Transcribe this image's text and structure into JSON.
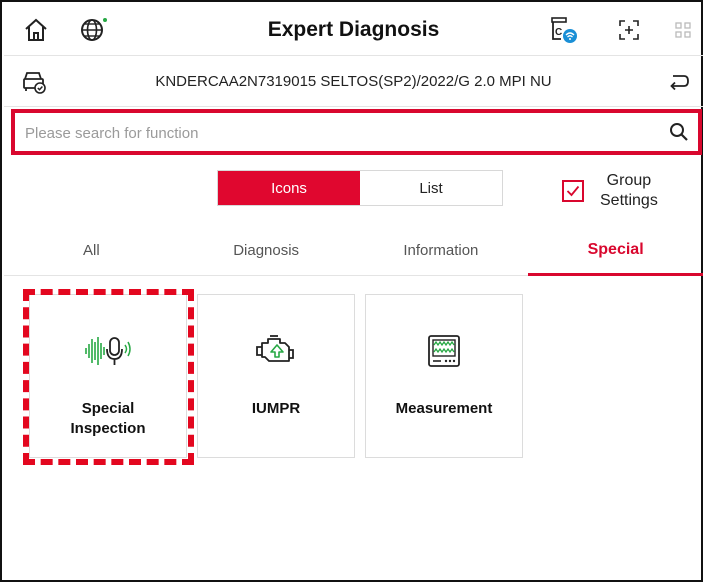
{
  "header": {
    "title": "Expert Diagnosis",
    "icons": [
      "home-icon",
      "globe-icon",
      "vci-connection-icon",
      "screenshot-icon",
      "grid-icon"
    ]
  },
  "vehicle": {
    "info": "KNDERCAA2N7319015 SELTOS(SP2)/2022/G 2.0 MPI NU"
  },
  "search": {
    "placeholder": "Please search for function",
    "value": ""
  },
  "view_toggle": {
    "icons_label": "Icons",
    "list_label": "List",
    "selected": "Icons"
  },
  "group_settings": {
    "label_line1": "Group",
    "label_line2": "Settings",
    "checked": true
  },
  "tabs": [
    {
      "label": "All",
      "active": false
    },
    {
      "label": "Diagnosis",
      "active": false
    },
    {
      "label": "Information",
      "active": false
    },
    {
      "label": "Special",
      "active": true
    }
  ],
  "cards": [
    {
      "line1": "Special",
      "line2": "Inspection",
      "icon": "sound-microphone-icon",
      "highlighted": true
    },
    {
      "line1": "IUMPR",
      "line2": "",
      "icon": "engine-icon",
      "highlighted": false
    },
    {
      "line1": "Measurement",
      "line2": "",
      "icon": "oscilloscope-icon",
      "highlighted": false
    }
  ],
  "colors": {
    "accent": "#e0072f",
    "highlight": "#e3071f",
    "icon_green": "#27a844"
  }
}
